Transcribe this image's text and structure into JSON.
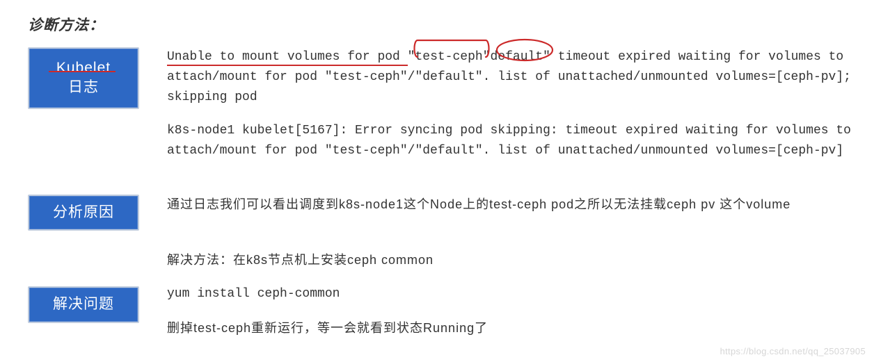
{
  "title": "诊断方法：",
  "labels": {
    "kubelet_line1": "Kubelet",
    "kubelet_line2": "日志",
    "analysis": "分析原因",
    "solve": "解决问题"
  },
  "log": {
    "p1_pre": "Unable to mount volumes for pod ",
    "p1_q1": "\"",
    "p1_testceph": "test-ceph",
    "p1_q2": "\"",
    "p1_default": "default\"",
    "p1_post": " timeout expired waiting for volumes to attach/mount for pod \"test-ceph\"/\"default\". list of unattached/unmounted volumes=[ceph-pv]; skipping pod",
    "p2": "k8s-node1 kubelet[5167]: Error syncing pod skipping: timeout expired waiting    for volumes to attach/mount for pod  \"test-ceph\"/\"default\".  list of unattached/unmounted volumes=[ceph-pv]"
  },
  "analysis_text": "通过日志我们可以看出调度到k8s-node1这个Node上的test-ceph pod之所以无法挂载ceph pv 这个volume",
  "solution": {
    "line1": "解决方法：在k8s节点机上安装ceph common",
    "line2": "yum install ceph-common",
    "line3": "删掉test-ceph重新运行，等一会就看到状态Running了"
  },
  "watermark": "https://blog.csdn.net/qq_25037905"
}
